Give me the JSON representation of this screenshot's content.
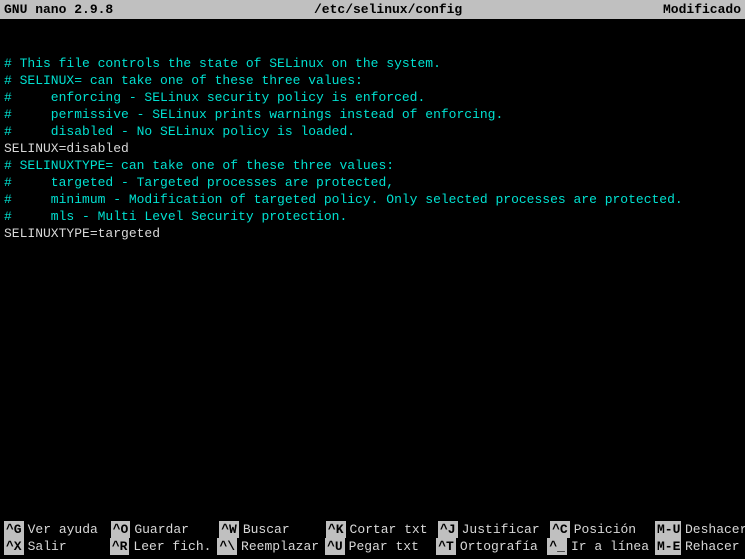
{
  "titlebar": {
    "app": "GNU nano 2.9.8",
    "filepath": "/etc/selinux/config",
    "status": "Modificado"
  },
  "lines": [
    {
      "type": "blank",
      "text": ""
    },
    {
      "type": "comment",
      "text": "# This file controls the state of SELinux on the system."
    },
    {
      "type": "comment",
      "text": "# SELINUX= can take one of these three values:"
    },
    {
      "type": "comment",
      "text": "#     enforcing - SELinux security policy is enforced."
    },
    {
      "type": "comment",
      "text": "#     permissive - SELinux prints warnings instead of enforcing."
    },
    {
      "type": "comment",
      "text": "#     disabled - No SELinux policy is loaded."
    },
    {
      "type": "plain",
      "text": "SELINUX=disabled"
    },
    {
      "type": "comment",
      "text": "# SELINUXTYPE= can take one of these three values:"
    },
    {
      "type": "comment",
      "text": "#     targeted - Targeted processes are protected,"
    },
    {
      "type": "comment",
      "text": "#     minimum - Modification of targeted policy. Only selected processes are protected."
    },
    {
      "type": "comment",
      "text": "#     mls - Multi Level Security protection."
    },
    {
      "type": "plain",
      "text": "SELINUXTYPE=targeted"
    }
  ],
  "shortcuts": {
    "row1": [
      {
        "key": "^G",
        "label": "Ver ayuda"
      },
      {
        "key": "^O",
        "label": "Guardar"
      },
      {
        "key": "^W",
        "label": "Buscar"
      },
      {
        "key": "^K",
        "label": "Cortar txt"
      },
      {
        "key": "^J",
        "label": "Justificar"
      },
      {
        "key": "^C",
        "label": "Posición"
      },
      {
        "key": "M-U",
        "label": "Deshacer"
      }
    ],
    "row2": [
      {
        "key": "^X",
        "label": "Salir"
      },
      {
        "key": "^R",
        "label": "Leer fich."
      },
      {
        "key": "^\\",
        "label": "Reemplazar"
      },
      {
        "key": "^U",
        "label": "Pegar txt"
      },
      {
        "key": "^T",
        "label": "Ortografía"
      },
      {
        "key": "^_",
        "label": "Ir a línea"
      },
      {
        "key": "M-E",
        "label": "Rehacer"
      }
    ]
  }
}
